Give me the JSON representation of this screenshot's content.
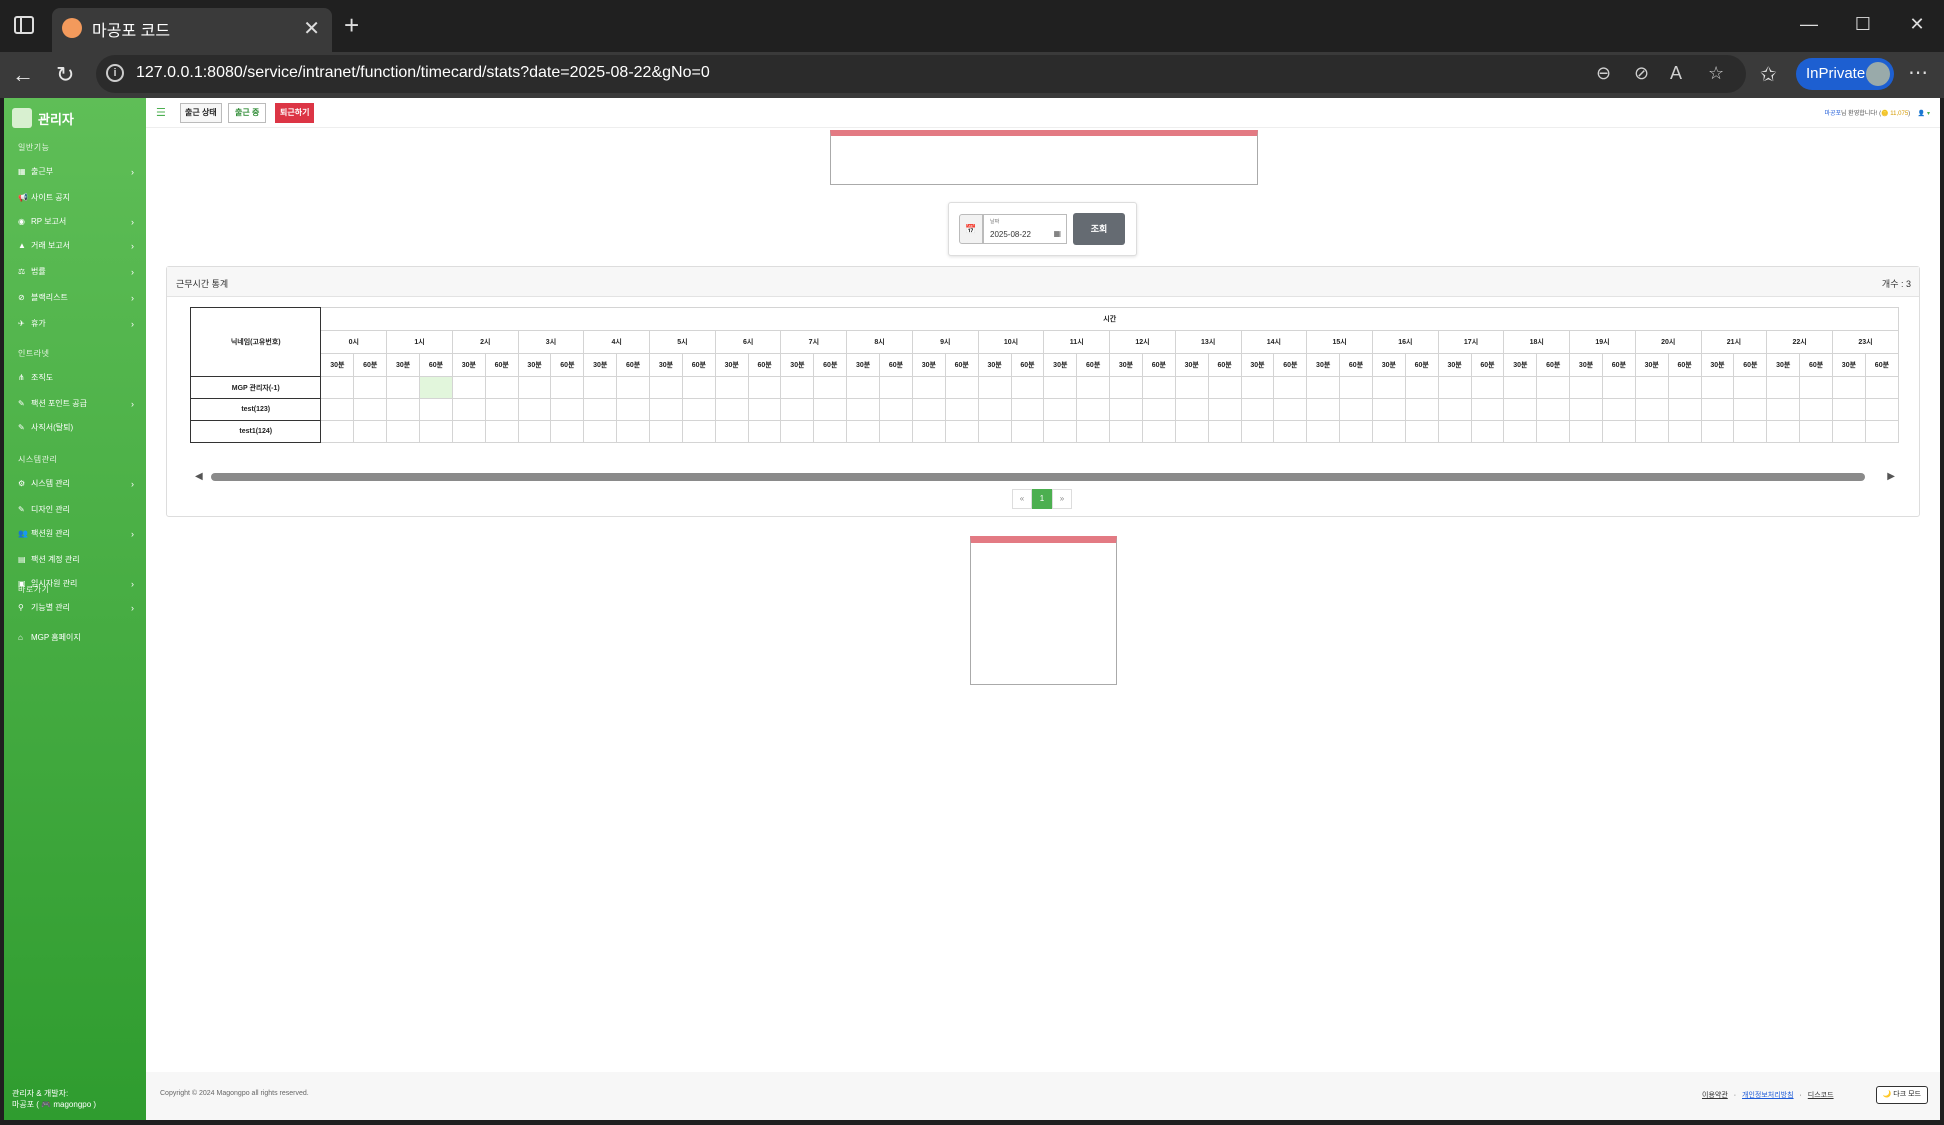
{
  "browser": {
    "tab_title": "마공포 코드",
    "url": "127.0.0.1:8080/service/intranet/function/timecard/stats?date=2025-08-22&gNo=0",
    "inprivate_label": "InPrivate"
  },
  "sidebar": {
    "brand": "관리자",
    "sections": [
      {
        "label": "일반기능"
      },
      {
        "label": "인트라넷"
      },
      {
        "label": "시스템관리"
      },
      {
        "label": "바로가기"
      }
    ],
    "items": [
      {
        "label": "출근부",
        "icon": "table-icon"
      },
      {
        "label": "사이트 공지",
        "icon": "megaphone-icon"
      },
      {
        "label": "RP 보고서",
        "icon": "eye-icon"
      },
      {
        "label": "거래 보고서",
        "icon": "warning-icon"
      },
      {
        "label": "법률",
        "icon": "scale-icon"
      },
      {
        "label": "블랙리스트",
        "icon": "ban-icon"
      },
      {
        "label": "휴가",
        "icon": "plane-icon"
      },
      {
        "label": "조직도",
        "icon": "org-icon"
      },
      {
        "label": "팩션 포인트 공급",
        "icon": "pen-icon"
      },
      {
        "label": "사직서(탈퇴)",
        "icon": "pen-icon"
      },
      {
        "label": "시스템 관리",
        "icon": "gear-icon"
      },
      {
        "label": "디자인 관리",
        "icon": "pen-icon"
      },
      {
        "label": "팩션원 관리",
        "icon": "users-icon"
      },
      {
        "label": "팩션 계정 관리",
        "icon": "card-icon"
      },
      {
        "label": "임시자원 관리",
        "icon": "box-icon"
      },
      {
        "label": "기능별 관리",
        "icon": "toggle-icon"
      },
      {
        "label": "MGP 홈페이지",
        "icon": "home-icon"
      }
    ],
    "footer_line1": "관리자 & 개발자:",
    "footer_line2": "마공포 ( 🎮 magongpo )"
  },
  "topnav": {
    "status_label": "출근 상태",
    "on_label": "출근 중",
    "off_label": "퇴근하기",
    "greeting_name": "마공포",
    "greeting_text": "님 환영합니다! (",
    "points": "🪙 11,075",
    "greeting_end": ")"
  },
  "search": {
    "date_label": "날짜",
    "date_value": "2025-08-22",
    "button": "조회"
  },
  "stats": {
    "title": "근무시간 통계",
    "count": "개수 : 3",
    "name_header": "닉네임(고유번호)",
    "time_header": "시간",
    "hours": [
      "0시",
      "1시",
      "2시",
      "3시",
      "4시",
      "5시",
      "6시",
      "7시",
      "8시",
      "9시",
      "10시",
      "11시",
      "12시",
      "13시",
      "14시",
      "15시",
      "16시",
      "17시",
      "18시",
      "19시",
      "20시",
      "21시",
      "22시",
      "23시"
    ],
    "min30": "30분",
    "min60": "60분",
    "rows": [
      {
        "name": "MGP 관리자(-1)",
        "worked_slots": [
          3
        ]
      },
      {
        "name": "test(123)",
        "worked_slots": []
      },
      {
        "name": "test1(124)",
        "worked_slots": []
      }
    ]
  },
  "pager": {
    "prev": "«",
    "current": "1",
    "next": "»"
  },
  "footer": {
    "copyright": "Copyright © 2024 Magongpo all rights reserved.",
    "terms": "이용약관",
    "privacy": "개인정보처리방침",
    "discord": "디스코드",
    "sep": "·",
    "dark_mode": "🌙 다크 모드"
  }
}
